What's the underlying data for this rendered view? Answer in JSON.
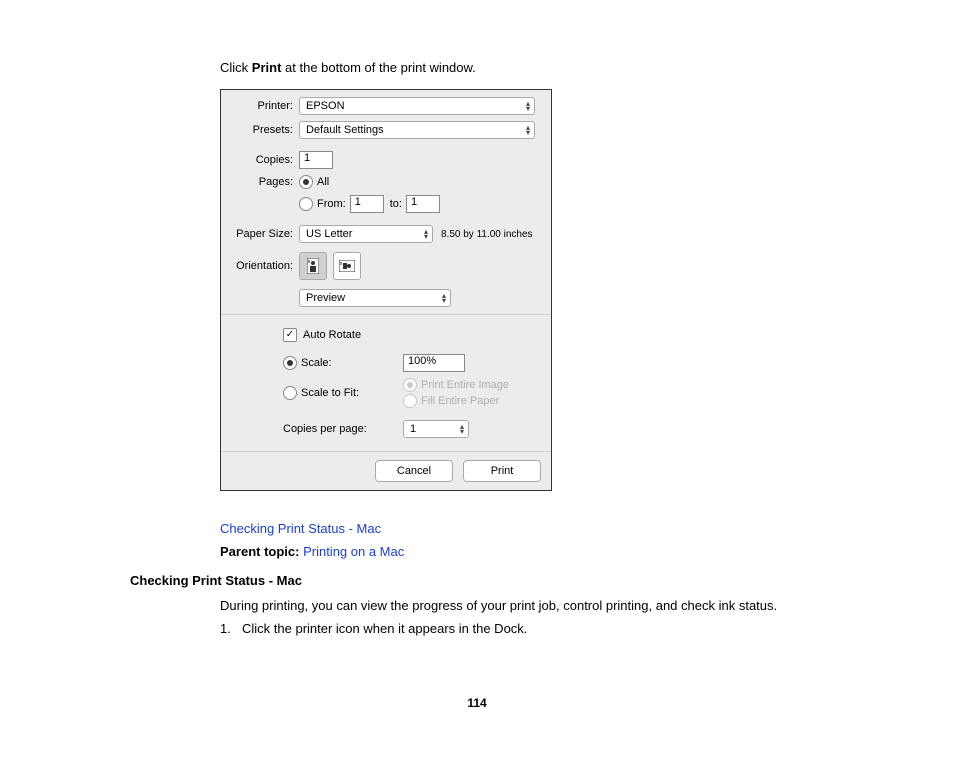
{
  "intro": {
    "pre": "Click ",
    "bold": "Print",
    "post": " at the bottom of the print window."
  },
  "dlg": {
    "labels": {
      "printer": "Printer:",
      "presets": "Presets:",
      "copies": "Copies:",
      "pages": "Pages:",
      "from": "From:",
      "to": "to:",
      "paperSize": "Paper Size:",
      "orientation": "Orientation:",
      "all": "All",
      "autoRotate": "Auto Rotate",
      "scale": "Scale:",
      "scaleToFit": "Scale to Fit:",
      "printEntire": "Print Entire Image",
      "fillPaper": "Fill Entire Paper",
      "copiesPerPage": "Copies per page:"
    },
    "values": {
      "printer": "EPSON",
      "presets": "Default Settings",
      "copies": "1",
      "from": "1",
      "to": "1",
      "paperSize": "US Letter",
      "paperDim": "8.50 by 11.00 inches",
      "mode": "Preview",
      "scale": "100%",
      "copiesPerPage": "1",
      "check": "✓"
    },
    "buttons": {
      "cancel": "Cancel",
      "print": "Print"
    }
  },
  "links": {
    "checkStatus": "Checking Print Status - Mac",
    "parentLabel": "Parent topic: ",
    "parentLink": "Printing on a Mac"
  },
  "section": {
    "heading": "Checking Print Status - Mac",
    "body": "During printing, you can view the progress of your print job, control printing, and check ink status.",
    "step1num": "1.",
    "step1": "Click the printer icon when it appears in the Dock."
  },
  "pageNumber": "114"
}
